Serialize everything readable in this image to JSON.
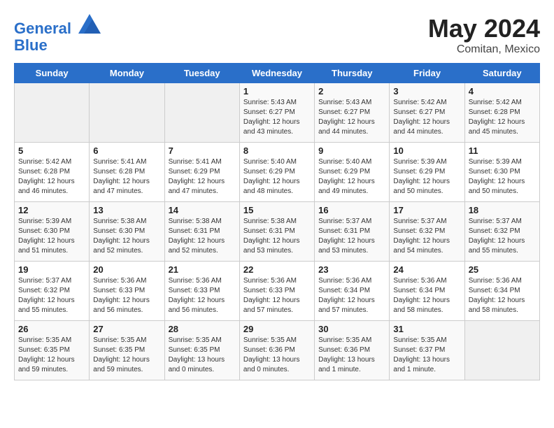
{
  "header": {
    "logo_line1": "General",
    "logo_line2": "Blue",
    "month": "May 2024",
    "location": "Comitan, Mexico"
  },
  "weekdays": [
    "Sunday",
    "Monday",
    "Tuesday",
    "Wednesday",
    "Thursday",
    "Friday",
    "Saturday"
  ],
  "weeks": [
    [
      {
        "day": "",
        "content": ""
      },
      {
        "day": "",
        "content": ""
      },
      {
        "day": "",
        "content": ""
      },
      {
        "day": "1",
        "content": "Sunrise: 5:43 AM\nSunset: 6:27 PM\nDaylight: 12 hours\nand 43 minutes."
      },
      {
        "day": "2",
        "content": "Sunrise: 5:43 AM\nSunset: 6:27 PM\nDaylight: 12 hours\nand 44 minutes."
      },
      {
        "day": "3",
        "content": "Sunrise: 5:42 AM\nSunset: 6:27 PM\nDaylight: 12 hours\nand 44 minutes."
      },
      {
        "day": "4",
        "content": "Sunrise: 5:42 AM\nSunset: 6:28 PM\nDaylight: 12 hours\nand 45 minutes."
      }
    ],
    [
      {
        "day": "5",
        "content": "Sunrise: 5:42 AM\nSunset: 6:28 PM\nDaylight: 12 hours\nand 46 minutes."
      },
      {
        "day": "6",
        "content": "Sunrise: 5:41 AM\nSunset: 6:28 PM\nDaylight: 12 hours\nand 47 minutes."
      },
      {
        "day": "7",
        "content": "Sunrise: 5:41 AM\nSunset: 6:29 PM\nDaylight: 12 hours\nand 47 minutes."
      },
      {
        "day": "8",
        "content": "Sunrise: 5:40 AM\nSunset: 6:29 PM\nDaylight: 12 hours\nand 48 minutes."
      },
      {
        "day": "9",
        "content": "Sunrise: 5:40 AM\nSunset: 6:29 PM\nDaylight: 12 hours\nand 49 minutes."
      },
      {
        "day": "10",
        "content": "Sunrise: 5:39 AM\nSunset: 6:29 PM\nDaylight: 12 hours\nand 50 minutes."
      },
      {
        "day": "11",
        "content": "Sunrise: 5:39 AM\nSunset: 6:30 PM\nDaylight: 12 hours\nand 50 minutes."
      }
    ],
    [
      {
        "day": "12",
        "content": "Sunrise: 5:39 AM\nSunset: 6:30 PM\nDaylight: 12 hours\nand 51 minutes."
      },
      {
        "day": "13",
        "content": "Sunrise: 5:38 AM\nSunset: 6:30 PM\nDaylight: 12 hours\nand 52 minutes."
      },
      {
        "day": "14",
        "content": "Sunrise: 5:38 AM\nSunset: 6:31 PM\nDaylight: 12 hours\nand 52 minutes."
      },
      {
        "day": "15",
        "content": "Sunrise: 5:38 AM\nSunset: 6:31 PM\nDaylight: 12 hours\nand 53 minutes."
      },
      {
        "day": "16",
        "content": "Sunrise: 5:37 AM\nSunset: 6:31 PM\nDaylight: 12 hours\nand 53 minutes."
      },
      {
        "day": "17",
        "content": "Sunrise: 5:37 AM\nSunset: 6:32 PM\nDaylight: 12 hours\nand 54 minutes."
      },
      {
        "day": "18",
        "content": "Sunrise: 5:37 AM\nSunset: 6:32 PM\nDaylight: 12 hours\nand 55 minutes."
      }
    ],
    [
      {
        "day": "19",
        "content": "Sunrise: 5:37 AM\nSunset: 6:32 PM\nDaylight: 12 hours\nand 55 minutes."
      },
      {
        "day": "20",
        "content": "Sunrise: 5:36 AM\nSunset: 6:33 PM\nDaylight: 12 hours\nand 56 minutes."
      },
      {
        "day": "21",
        "content": "Sunrise: 5:36 AM\nSunset: 6:33 PM\nDaylight: 12 hours\nand 56 minutes."
      },
      {
        "day": "22",
        "content": "Sunrise: 5:36 AM\nSunset: 6:33 PM\nDaylight: 12 hours\nand 57 minutes."
      },
      {
        "day": "23",
        "content": "Sunrise: 5:36 AM\nSunset: 6:34 PM\nDaylight: 12 hours\nand 57 minutes."
      },
      {
        "day": "24",
        "content": "Sunrise: 5:36 AM\nSunset: 6:34 PM\nDaylight: 12 hours\nand 58 minutes."
      },
      {
        "day": "25",
        "content": "Sunrise: 5:36 AM\nSunset: 6:34 PM\nDaylight: 12 hours\nand 58 minutes."
      }
    ],
    [
      {
        "day": "26",
        "content": "Sunrise: 5:35 AM\nSunset: 6:35 PM\nDaylight: 12 hours\nand 59 minutes."
      },
      {
        "day": "27",
        "content": "Sunrise: 5:35 AM\nSunset: 6:35 PM\nDaylight: 12 hours\nand 59 minutes."
      },
      {
        "day": "28",
        "content": "Sunrise: 5:35 AM\nSunset: 6:35 PM\nDaylight: 13 hours\nand 0 minutes."
      },
      {
        "day": "29",
        "content": "Sunrise: 5:35 AM\nSunset: 6:36 PM\nDaylight: 13 hours\nand 0 minutes."
      },
      {
        "day": "30",
        "content": "Sunrise: 5:35 AM\nSunset: 6:36 PM\nDaylight: 13 hours\nand 1 minute."
      },
      {
        "day": "31",
        "content": "Sunrise: 5:35 AM\nSunset: 6:37 PM\nDaylight: 13 hours\nand 1 minute."
      },
      {
        "day": "",
        "content": ""
      }
    ]
  ]
}
